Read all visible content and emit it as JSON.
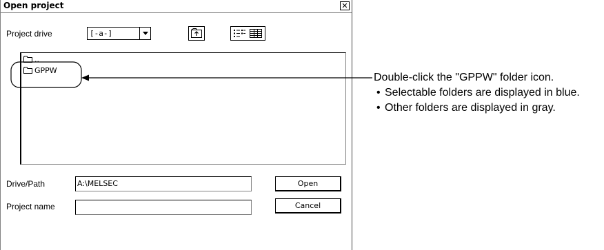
{
  "dialog": {
    "title": "Open project",
    "close_glyph": "✕",
    "project_drive_label": "Project drive",
    "drive_value": "[-a-]",
    "list_items": [
      {
        "label": "..",
        "icon": "folder-icon"
      },
      {
        "label": "GPPW",
        "icon": "folder-icon"
      }
    ],
    "drive_path_label": "Drive/Path",
    "drive_path_value": "A:\\MELSEC",
    "project_name_label": "Project name",
    "project_name_value": "",
    "open_button": "Open",
    "cancel_button": "Cancel"
  },
  "annotation": {
    "main": "Double-click the \"GPPW\" folder icon.",
    "bullets": [
      "Selectable folders are displayed in blue.",
      "Other folders are displayed in gray."
    ]
  }
}
